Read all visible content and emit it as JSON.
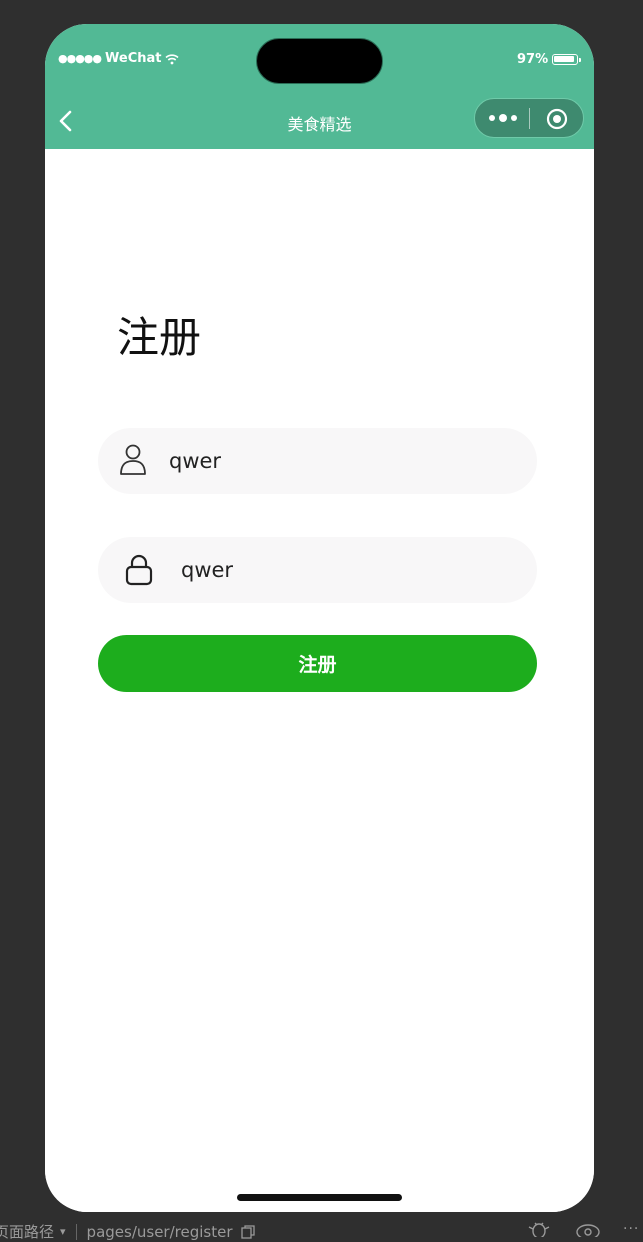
{
  "status_bar": {
    "carrier_dots": "●●●●●",
    "carrier": "WeChat",
    "wifi_icon": "wifi-icon",
    "battery_text": "97%",
    "battery_level": 0.97
  },
  "nav": {
    "title": "美食精选",
    "back_icon": "chevron-left-icon",
    "more_icon": "more-dots-icon",
    "close_icon": "target-circle-icon",
    "bar_color": "#52b995"
  },
  "form": {
    "title": "注册",
    "username": {
      "value": "qwer",
      "icon": "user-icon"
    },
    "password": {
      "value": "qwer",
      "icon": "lock-icon"
    },
    "submit_label": "注册",
    "submit_color": "#1dad1d"
  },
  "ide": {
    "page_path_label": "页面路径",
    "page_path": "pages/user/register"
  }
}
